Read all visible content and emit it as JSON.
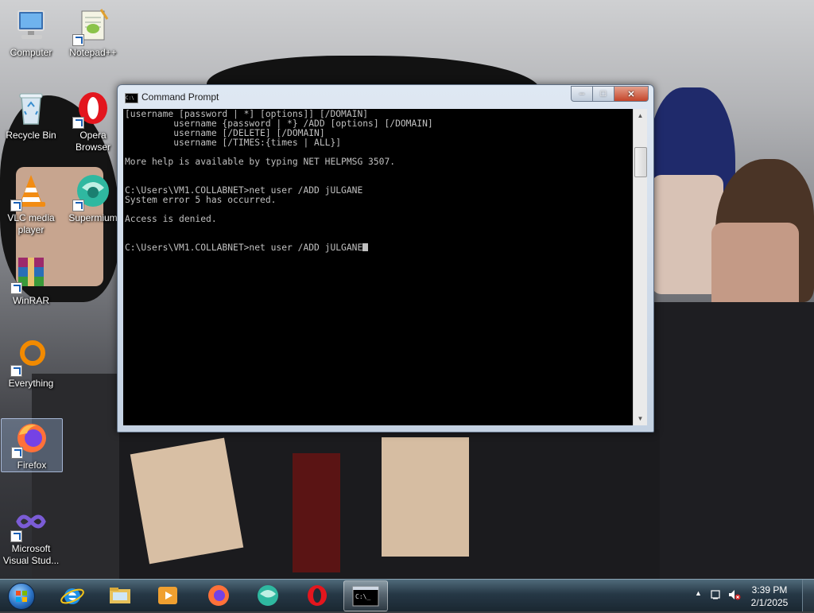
{
  "desktop": {
    "icons": [
      {
        "label": "Computer",
        "icon": "computer-icon"
      },
      {
        "label": "Notepad++",
        "icon": "notepadpp-icon"
      },
      {
        "label": "Recycle Bin",
        "icon": "recycle-bin-icon"
      },
      {
        "label": "Opera Browser",
        "icon": "opera-icon"
      },
      {
        "label": "VLC media player",
        "icon": "vlc-icon"
      },
      {
        "label": "Supermium",
        "icon": "supermium-icon"
      },
      {
        "label": "WinRAR",
        "icon": "winrar-icon"
      },
      {
        "label": "Everything",
        "icon": "everything-icon"
      },
      {
        "label": "Firefox",
        "icon": "firefox-icon"
      },
      {
        "label": "Microsoft Visual Stud...",
        "icon": "visual-studio-icon"
      }
    ]
  },
  "window": {
    "title": "Command Prompt",
    "console_lines": [
      "[username [password | *] [options]] [/DOMAIN]",
      "         username {password | *} /ADD [options] [/DOMAIN]",
      "         username [/DELETE] [/DOMAIN]",
      "         username [/TIMES:{times | ALL}]",
      "",
      "More help is available by typing NET HELPMSG 3507.",
      "",
      "",
      "C:\\Users\\VM1.COLLABNET>net user /ADD jULGANE",
      "System error 5 has occurred.",
      "",
      "Access is denied.",
      "",
      "",
      "C:\\Users\\VM1.COLLABNET>net user /ADD jULGANE"
    ],
    "buttons": {
      "minimize": "–",
      "maximize": "□",
      "close": "✕"
    }
  },
  "taskbar": {
    "pinned": [
      "internet-explorer-icon",
      "file-explorer-icon",
      "media-player-icon",
      "firefox-icon",
      "supermium-icon",
      "opera-icon",
      "command-prompt-icon"
    ],
    "time": "3:39 PM",
    "date": "2/1/2025"
  }
}
